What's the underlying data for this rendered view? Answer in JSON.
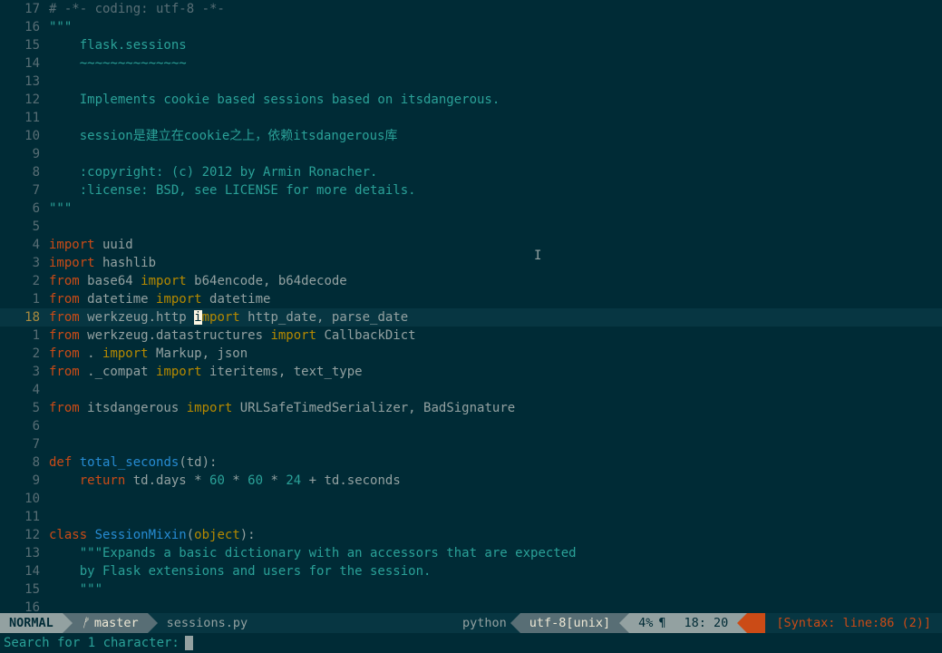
{
  "gutter": [
    "17",
    "16",
    "15",
    "14",
    "13",
    "12",
    "11",
    "10",
    "9",
    "8",
    "7",
    "6",
    "5",
    "4",
    "3",
    "2",
    "1",
    "18",
    "1",
    "2",
    "3",
    "4",
    "5",
    "6",
    "7",
    "8",
    "9",
    "10",
    "11",
    "12",
    "13",
    "14",
    "15",
    "16"
  ],
  "code": {
    "l0_comment": "# -*- coding: utf-8 -*-",
    "l1": "\"\"\"",
    "l2": "    flask.sessions",
    "l3": "    ~~~~~~~~~~~~~~",
    "l4": "",
    "l5": "    Implements cookie based sessions based on itsdangerous.",
    "l6": "",
    "l7": "    session是建立在cookie之上，依赖itsdangerous库",
    "l8": "",
    "l9": "    :copyright: (c) 2012 by Armin Ronacher.",
    "l10": "    :license: BSD, see LICENSE for more details.",
    "l11": "\"\"\"",
    "l12": "",
    "imp": "import",
    "frm": "from",
    "uuid": " uuid",
    "hashlib": " hashlib",
    "base64": " base64 ",
    "base64_names": " b64encode, b64decode",
    "datetime_mod": " datetime ",
    "datetime_names": " datetime",
    "werkzeug_http": " werkzeug.http ",
    "sel_char": "i",
    "mport_rest": "mport",
    "http_names": " http_date, parse_date",
    "werkzeug_ds": " werkzeug.datastructures ",
    "cbdict": " CallbackDict",
    "dot": " . ",
    "markup_json": " Markup, json",
    "compat": " ._compat ",
    "iteritems": " iteritems, text_type",
    "itsdangerous": " itsdangerous ",
    "serializer": " URLSafeTimedSerializer, BadSignature",
    "def": "def",
    "total_seconds": " total_seconds",
    "td_sig": "(td):",
    "return": "return",
    "ret_expr_a": " td.days * ",
    "n60a": "60",
    "times": " * ",
    "n60b": "60",
    "n24": "24",
    "plus_sec": " + td.seconds",
    "class": "class",
    "SessionMixin": " SessionMixin",
    "open_paren": "(",
    "object": "object",
    "close_sig": "):",
    "doc13": "    \"\"\"Expands a basic dictionary with an accessors that are expected",
    "doc14": "    by Flask extensions and users for the session.",
    "doc15": "    \"\"\""
  },
  "status": {
    "mode": "NORMAL",
    "branch_icon": "ᚠ",
    "branch": "master",
    "filename": "sessions.py",
    "filetype": "python",
    "encoding": "utf-8[unix]",
    "percent": "4%",
    "linecol": "18: 20",
    "syntax_err": "[Syntax: line:86 (2)]"
  },
  "cmdline": {
    "prompt": "Search for 1 character:"
  }
}
